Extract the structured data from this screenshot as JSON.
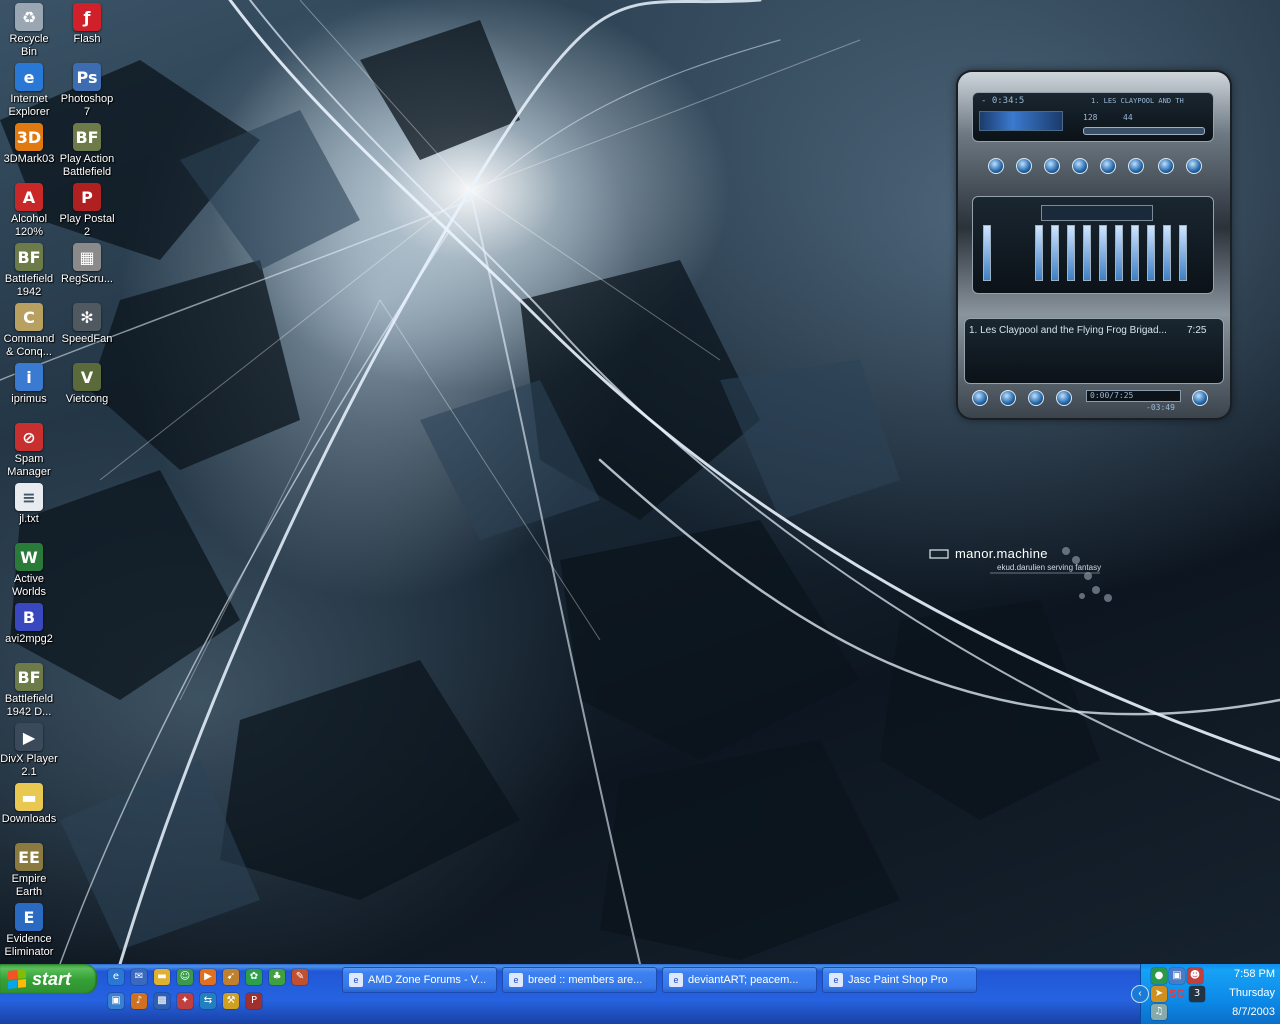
{
  "desktop": {
    "icons": [
      {
        "label": "Recycle Bin",
        "icon": "recycle-bin-icon",
        "color": "#9aa7b3"
      },
      {
        "label": "Flash",
        "icon": "flash-icon",
        "color": "#d0202a"
      },
      {
        "label": "Internet Explorer",
        "icon": "internet-explorer-icon",
        "color": "#2a78d6"
      },
      {
        "label": "Photoshop 7",
        "icon": "photoshop-icon",
        "color": "#3d6db0"
      },
      {
        "label": "3DMark03",
        "icon": "3dmark-icon",
        "color": "#e07a10"
      },
      {
        "label": "Play Action Battlefield",
        "icon": "battlefield-icon",
        "color": "#6d7a4a"
      },
      {
        "label": "Alcohol 120%",
        "icon": "alcohol-icon",
        "color": "#c82828"
      },
      {
        "label": "Play Postal 2",
        "icon": "postal-icon",
        "color": "#b02020"
      },
      {
        "label": "Battlefield 1942",
        "icon": "battlefield-icon",
        "color": "#6d7a4a"
      },
      {
        "label": "RegScru...",
        "icon": "regscrub-icon",
        "color": "#8a8a8a"
      },
      {
        "label": "Command & Conq...",
        "icon": "command-conquer-icon",
        "color": "#b8a060"
      },
      {
        "label": "SpeedFan",
        "icon": "speedfan-icon",
        "color": "#505860"
      },
      {
        "label": "iprimus",
        "icon": "iprimus-icon",
        "color": "#3a7ad0"
      },
      {
        "label": "Vietcong",
        "icon": "vietcong-icon",
        "color": "#5a6a3a"
      },
      {
        "label": "Spam Manager",
        "icon": "spam-manager-icon",
        "color": "#c83030"
      },
      {
        "label": "jl.txt",
        "icon": "text-file-icon",
        "color": "#e8ecf0"
      },
      {
        "label": "Active Worlds",
        "icon": "active-worlds-icon",
        "color": "#2a7a3a"
      },
      {
        "label": "avi2mpg2",
        "icon": "avi2mpg2-icon",
        "color": "#3a48c0"
      },
      {
        "label": "Battlefield 1942 D...",
        "icon": "battlefield-icon",
        "color": "#6d7a4a"
      },
      {
        "label": "DivX Player 2.1",
        "icon": "divx-icon",
        "color": "#3a4a5a"
      },
      {
        "label": "Downloads",
        "icon": "folder-icon",
        "color": "#e8c850"
      },
      {
        "label": "Empire Earth",
        "icon": "empire-earth-icon",
        "color": "#8a7a40"
      },
      {
        "label": "Evidence Eliminator",
        "icon": "evidence-eliminator-icon",
        "color": "#2a6ac0"
      }
    ]
  },
  "wallpaper": {
    "brand": "manor.machine",
    "tagline": "ekud.darulien serving fantasy"
  },
  "winamp": {
    "time": "- 0:34:5",
    "title_scroll": "1. LES CLAYPOOL AND TH",
    "bitrate": "128",
    "samplerate": "44",
    "playlist_item": "1. Les Claypool and the Flying Frog Brigad...",
    "playlist_length": "7:25",
    "playlist_time": "0:00/7:25",
    "playlist_remaining": "-03:49"
  },
  "taskbar": {
    "start_label": "start",
    "tasks": [
      {
        "label": "AMD Zone Forums - V...",
        "icon": "ie-page-icon"
      },
      {
        "label": "breed :: members are...",
        "icon": "ie-page-icon"
      },
      {
        "label": "deviantART; peacem...",
        "icon": "ie-page-icon"
      },
      {
        "label": "Jasc Paint Shop Pro",
        "icon": "paint-shop-pro-icon"
      }
    ],
    "clock": {
      "time": "7:58 PM",
      "day": "Thursday",
      "date": "8/7/2003"
    },
    "tray_text": "SG"
  }
}
